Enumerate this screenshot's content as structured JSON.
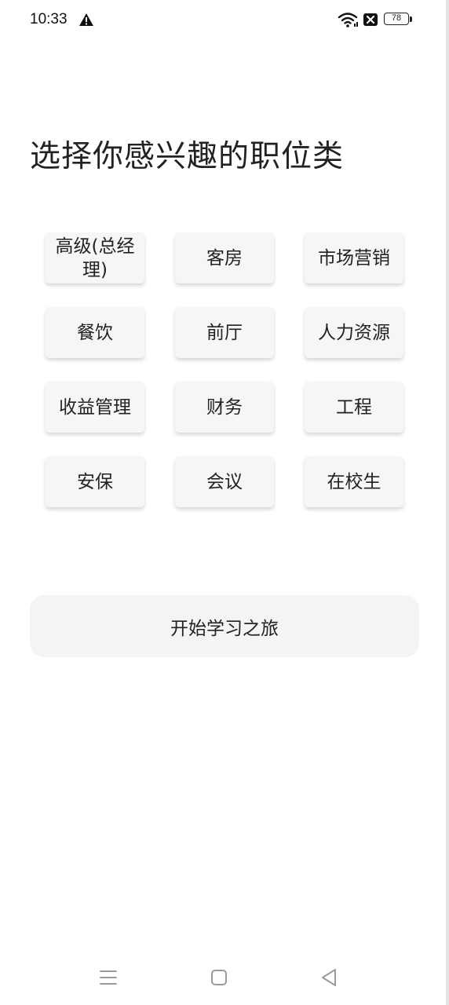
{
  "status_bar": {
    "time": "10:33",
    "battery_level": "78",
    "icons": [
      "warning-icon",
      "wifi-icon",
      "sim-disabled-icon",
      "battery-icon"
    ]
  },
  "title": "选择你感兴趣的职位类",
  "categories": [
    {
      "label": "高级(总经理)"
    },
    {
      "label": "客房"
    },
    {
      "label": "市场营销"
    },
    {
      "label": "餐饮"
    },
    {
      "label": "前厅"
    },
    {
      "label": "人力资源"
    },
    {
      "label": "收益管理"
    },
    {
      "label": "财务"
    },
    {
      "label": "工程"
    },
    {
      "label": "安保"
    },
    {
      "label": "会议"
    },
    {
      "label": "在校生"
    }
  ],
  "start_button": {
    "label": "开始学习之旅"
  },
  "nav_bar": {
    "icons": [
      "menu-icon",
      "home-icon",
      "back-icon"
    ]
  },
  "colors": {
    "card_background": "#f6f6f6",
    "button_background": "#f3f4f5",
    "text": "#222222"
  }
}
